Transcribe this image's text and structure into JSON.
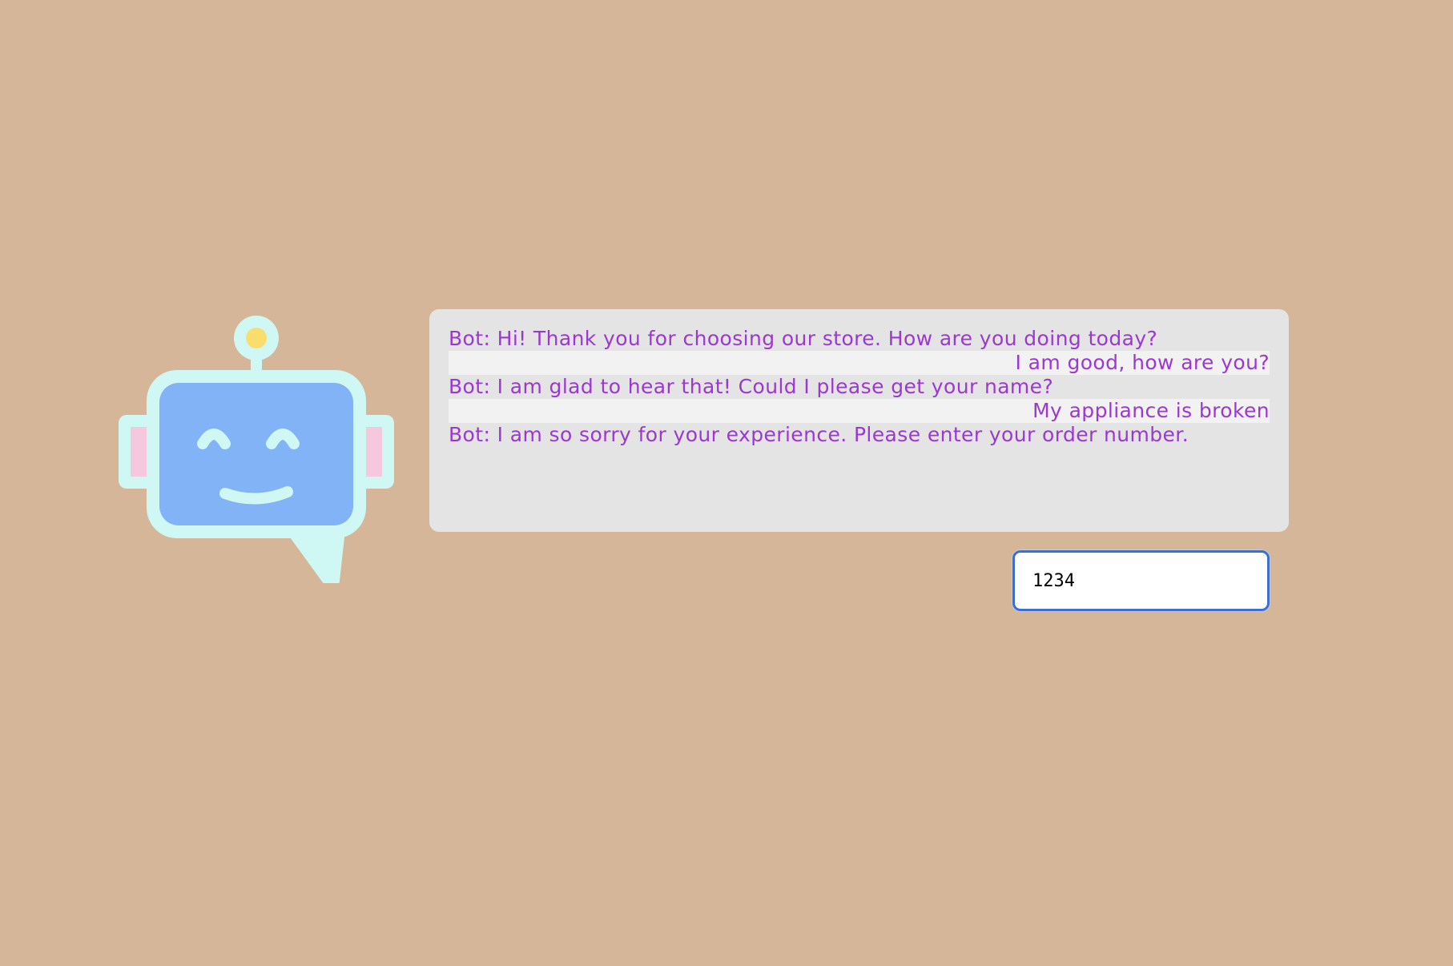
{
  "robot": {
    "icon": "robot-chat-icon",
    "colors": {
      "outline": "#cff7f4",
      "face": "#83b3f7",
      "ear": "#f6c8dd",
      "antenna_light": "#f9de6e"
    }
  },
  "chat": {
    "messages": [
      {
        "sender": "bot",
        "text": "Bot: Hi! Thank you for choosing our store. How are you doing today?"
      },
      {
        "sender": "user",
        "text": "I am good, how are you?"
      },
      {
        "sender": "bot",
        "text": "Bot: I am glad to hear that! Could I please get your name?"
      },
      {
        "sender": "user",
        "text": "My appliance is broken"
      },
      {
        "sender": "bot",
        "text": "Bot: I am so sorry for your experience. Please enter your order number."
      }
    ]
  },
  "input": {
    "value": "1234",
    "placeholder": ""
  },
  "colors": {
    "background": "#d5b698",
    "panel": "#e4e4e4",
    "message_text": "#9b38d2",
    "user_highlight": "#f2f2f2",
    "input_border": "#3b6fd1"
  }
}
